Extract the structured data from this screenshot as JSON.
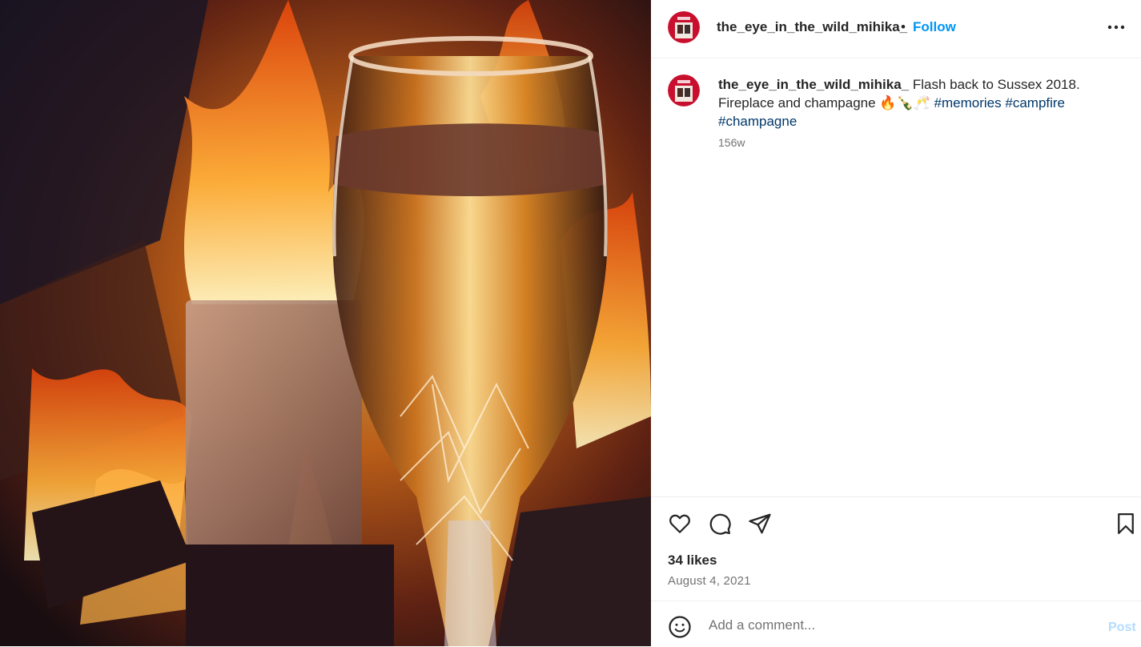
{
  "post": {
    "username": "the_eye_in_the_wild_mihika_",
    "follow_separator": "•",
    "follow_label": "Follow",
    "more_icon": "more-horizontal-icon",
    "caption": {
      "username": "the_eye_in_the_wild_mihika_",
      "text": " Flash back to Sussex 2018. Fireplace and champagne ",
      "emojis": "🔥🍾🥂",
      "hashtags": [
        "#memories",
        "#campfire",
        "#champagne"
      ],
      "time_ago": "156w"
    },
    "actions": {
      "like_icon": "heart-icon",
      "comment_icon": "comment-icon",
      "share_icon": "share-icon",
      "save_icon": "bookmark-icon"
    },
    "likes": "34 likes",
    "date": "August 4, 2021",
    "comment": {
      "emoji_icon": "emoji-icon",
      "placeholder": "Add a comment...",
      "post_label": "Post"
    }
  },
  "colors": {
    "accent": "#0095f6",
    "hashtag": "#00376b",
    "muted": "#737373",
    "post_disabled": "#b3dbff"
  }
}
